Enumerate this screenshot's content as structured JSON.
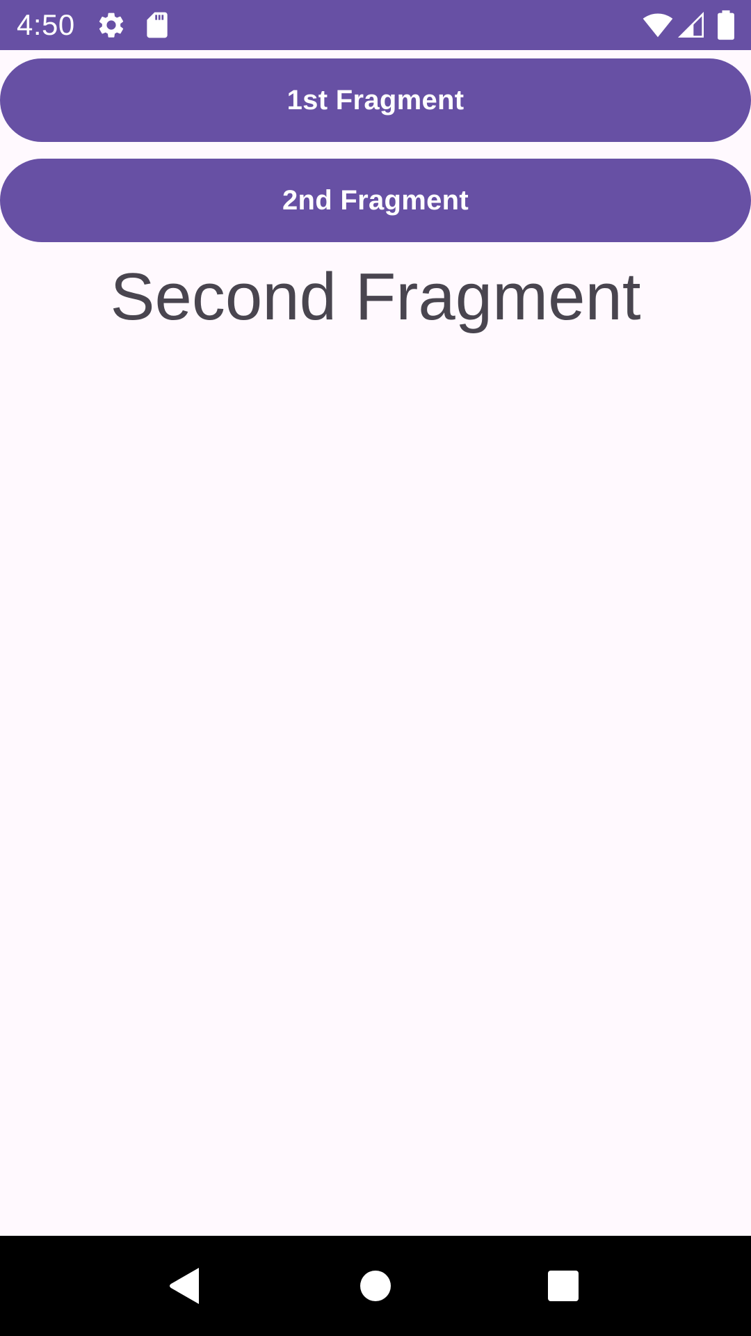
{
  "status_bar": {
    "time": "4:50",
    "left_icons": [
      "settings-icon",
      "sd-card-icon"
    ],
    "right_icons": [
      "wifi-icon",
      "cell-signal-icon",
      "battery-icon"
    ],
    "background_color": "#6750A4"
  },
  "buttons": {
    "first_label": "1st Fragment",
    "second_label": "2nd Fragment",
    "color": "#6750A4"
  },
  "fragment": {
    "title": "Second Fragment"
  },
  "nav_bar": {
    "icons": [
      "back-icon",
      "home-icon",
      "recents-icon"
    ]
  }
}
